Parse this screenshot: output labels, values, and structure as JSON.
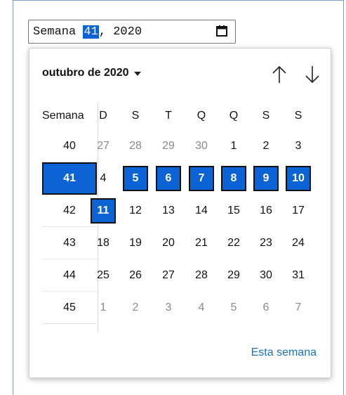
{
  "input": {
    "prefix": "Semana ",
    "week": "41",
    "suffix": ", 2020"
  },
  "picker": {
    "month_label": "outubro de 2020",
    "week_header": "Semana",
    "weekdays": [
      "D",
      "S",
      "T",
      "Q",
      "Q",
      "S",
      "S"
    ],
    "today_label": "Esta semana",
    "rows": [
      {
        "week": "40",
        "selected": false,
        "days": [
          {
            "d": "27",
            "out": true
          },
          {
            "d": "28",
            "out": true
          },
          {
            "d": "29",
            "out": true
          },
          {
            "d": "30",
            "out": true
          },
          {
            "d": "1"
          },
          {
            "d": "2"
          },
          {
            "d": "3"
          }
        ]
      },
      {
        "week": "41",
        "selected": true,
        "days": [
          {
            "d": "4"
          },
          {
            "d": "5",
            "sel": true
          },
          {
            "d": "6",
            "sel": true
          },
          {
            "d": "7",
            "sel": true
          },
          {
            "d": "8",
            "sel": true
          },
          {
            "d": "9",
            "sel": true
          },
          {
            "d": "10",
            "sel": true
          }
        ]
      },
      {
        "week": "42",
        "selected": false,
        "days": [
          {
            "d": "11",
            "sel": true
          },
          {
            "d": "12"
          },
          {
            "d": "13"
          },
          {
            "d": "14"
          },
          {
            "d": "15"
          },
          {
            "d": "16"
          },
          {
            "d": "17"
          }
        ]
      },
      {
        "week": "43",
        "selected": false,
        "days": [
          {
            "d": "18"
          },
          {
            "d": "19"
          },
          {
            "d": "20"
          },
          {
            "d": "21"
          },
          {
            "d": "22"
          },
          {
            "d": "23"
          },
          {
            "d": "24"
          }
        ]
      },
      {
        "week": "44",
        "selected": false,
        "days": [
          {
            "d": "25"
          },
          {
            "d": "26"
          },
          {
            "d": "27"
          },
          {
            "d": "28"
          },
          {
            "d": "29"
          },
          {
            "d": "30"
          },
          {
            "d": "31"
          }
        ]
      },
      {
        "week": "45",
        "selected": false,
        "days": [
          {
            "d": "1",
            "out": true
          },
          {
            "d": "2",
            "out": true
          },
          {
            "d": "3",
            "out": true
          },
          {
            "d": "4",
            "out": true
          },
          {
            "d": "5",
            "out": true
          },
          {
            "d": "6",
            "out": true
          },
          {
            "d": "7",
            "out": true
          }
        ]
      }
    ]
  },
  "icons": {
    "calendar": "calendar-icon",
    "prev": "arrow-up-icon",
    "next": "arrow-down-icon",
    "caret": "caret-down-icon"
  },
  "colors": {
    "accent": "#0b63d6",
    "link": "#1a73c8"
  }
}
